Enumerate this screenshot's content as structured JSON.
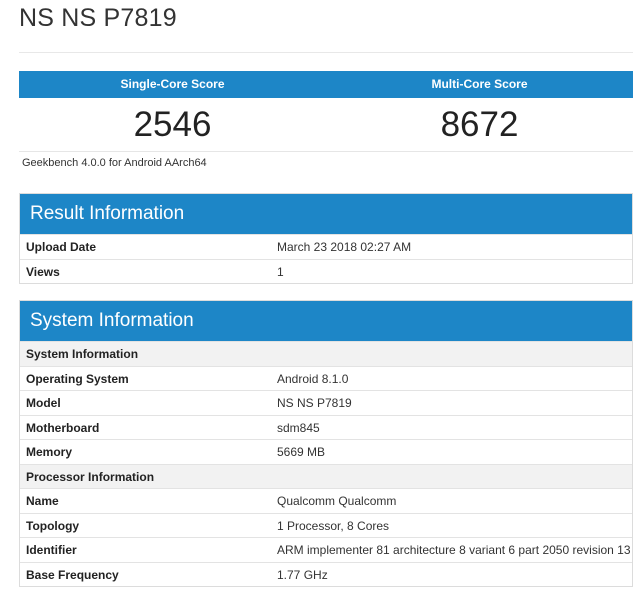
{
  "page": {
    "title": "NS NS P7819"
  },
  "scores": {
    "single_label": "Single-Core Score",
    "multi_label": "Multi-Core Score",
    "single_value": "2546",
    "multi_value": "8672",
    "version": "Geekbench 4.0.0 for Android AArch64"
  },
  "result_info": {
    "heading": "Result Information",
    "rows": [
      {
        "label": "Upload Date",
        "value": "March 23 2018 02:27 AM"
      },
      {
        "label": "Views",
        "value": "1"
      }
    ]
  },
  "system_info": {
    "heading": "System Information",
    "section1": "System Information",
    "rows1": [
      {
        "label": "Operating System",
        "value": "Android 8.1.0"
      },
      {
        "label": "Model",
        "value": "NS NS P7819"
      },
      {
        "label": "Motherboard",
        "value": "sdm845"
      },
      {
        "label": "Memory",
        "value": "5669 MB"
      }
    ],
    "section2": "Processor Information",
    "rows2": [
      {
        "label": "Name",
        "value": "Qualcomm Qualcomm"
      },
      {
        "label": "Topology",
        "value": "1 Processor, 8 Cores"
      },
      {
        "label": "Identifier",
        "value": "ARM implementer 81 architecture 8 variant 6 part 2050 revision 13"
      },
      {
        "label": "Base Frequency",
        "value": "1.77 GHz"
      }
    ]
  },
  "colors": {
    "accent": "#1d86c7",
    "section_bg": "#f2f2f2"
  }
}
